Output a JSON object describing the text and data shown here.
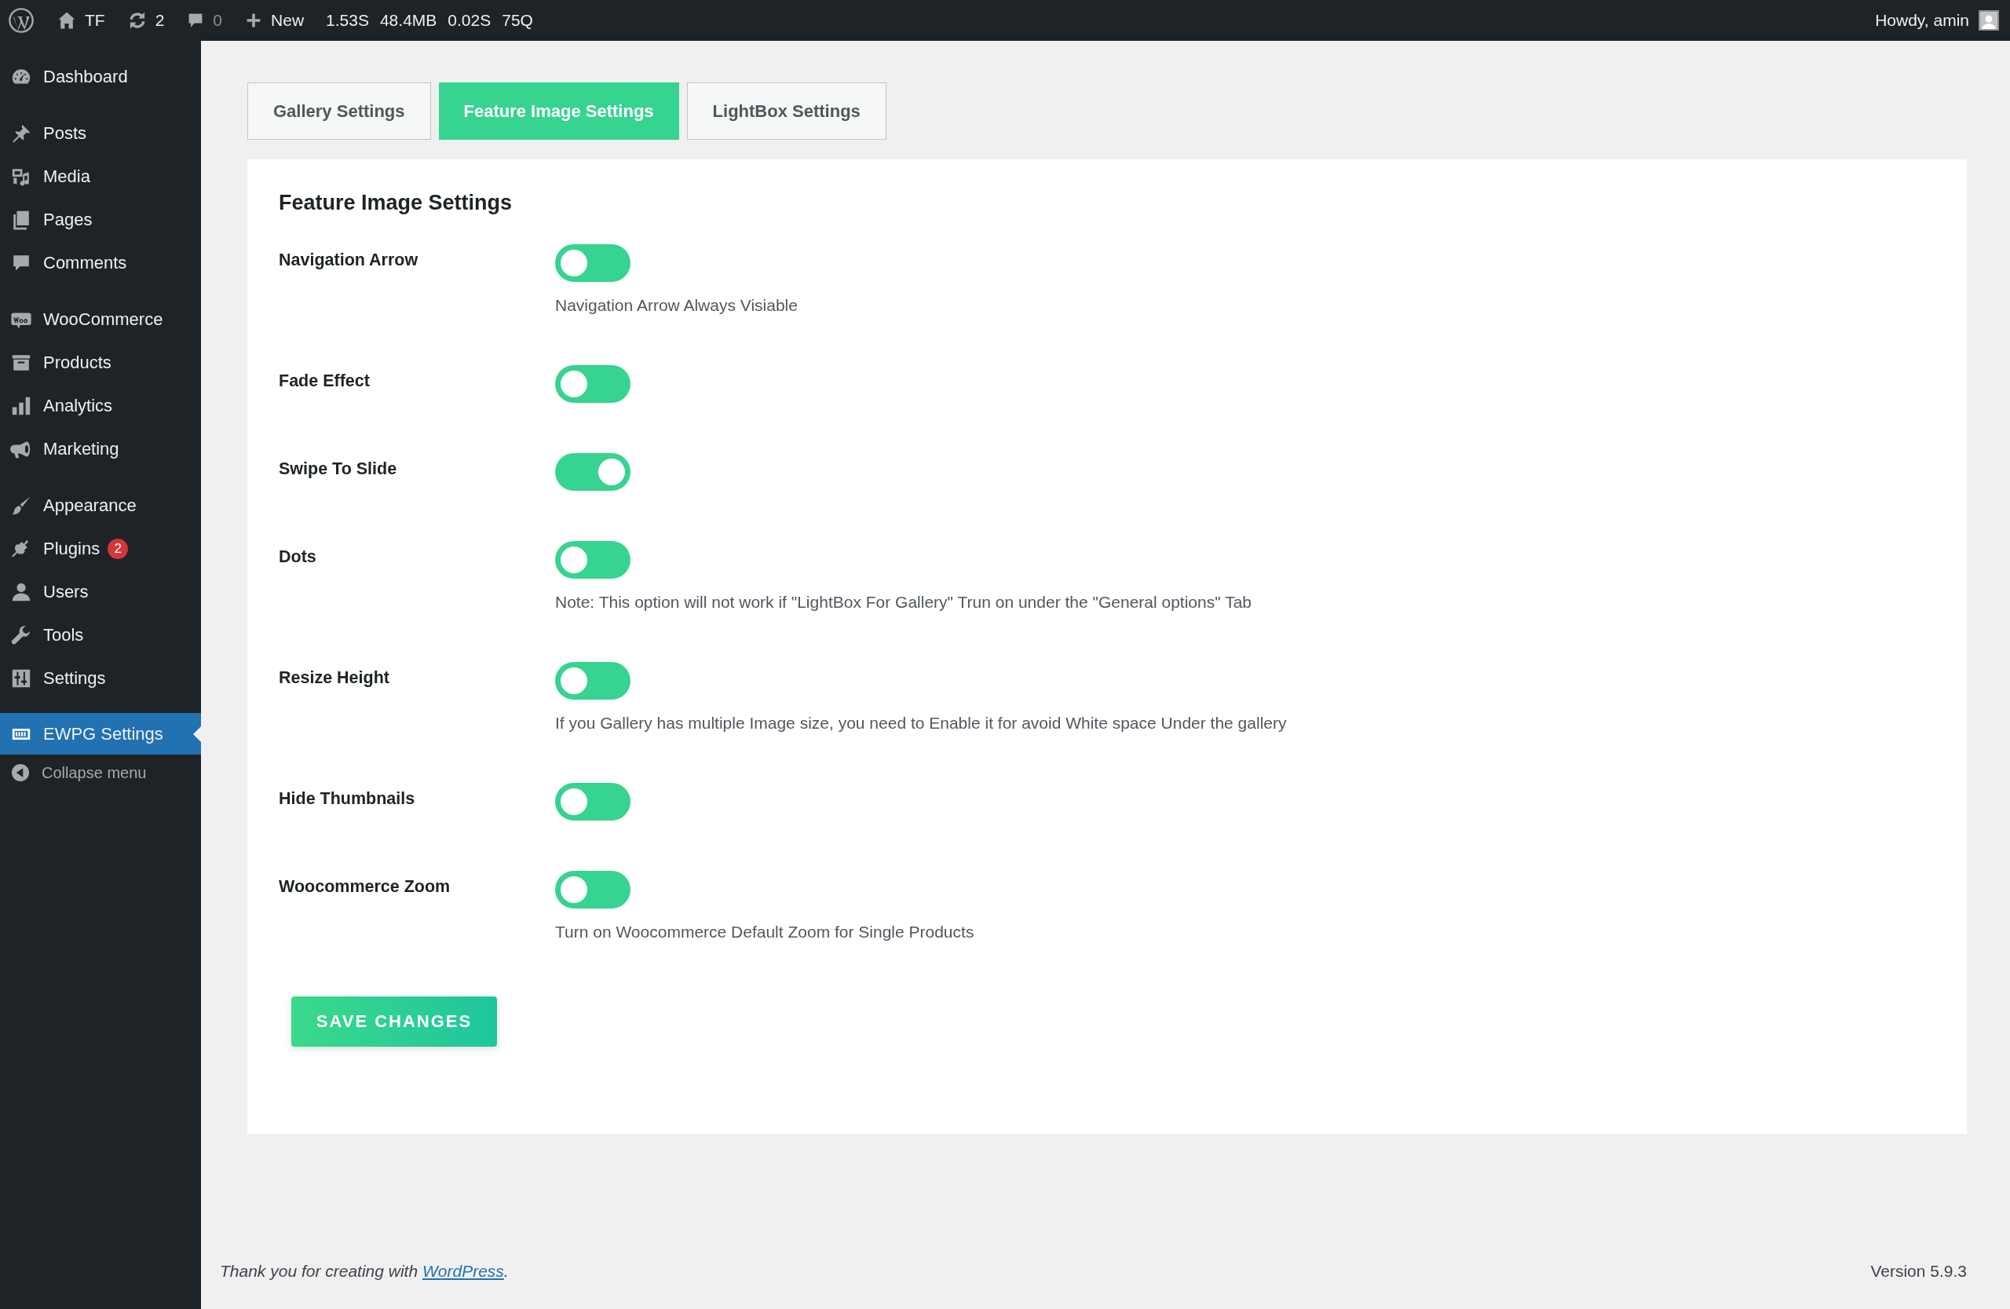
{
  "admin_bar": {
    "site": "TF",
    "updates": "2",
    "comments": "0",
    "new": "New",
    "stats": [
      "1.53S",
      "48.4MB",
      "0.02S",
      "75Q"
    ],
    "greeting": "Howdy, amin"
  },
  "sidebar": {
    "groups": [
      [
        {
          "label": "Dashboard",
          "kind": "dashboard",
          "selected": false
        }
      ],
      [
        {
          "label": "Posts",
          "kind": "pin",
          "selected": false
        },
        {
          "label": "Media",
          "kind": "media",
          "selected": false
        },
        {
          "label": "Pages",
          "kind": "pages",
          "selected": false
        },
        {
          "label": "Comments",
          "kind": "comment",
          "selected": false
        }
      ],
      [
        {
          "label": "WooCommerce",
          "kind": "woo",
          "selected": false
        },
        {
          "label": "Products",
          "kind": "archive",
          "selected": false
        },
        {
          "label": "Analytics",
          "kind": "chart",
          "selected": false
        },
        {
          "label": "Marketing",
          "kind": "megaphone",
          "selected": false
        }
      ],
      [
        {
          "label": "Appearance",
          "kind": "brush",
          "selected": false
        },
        {
          "label": "Plugins",
          "kind": "plug",
          "selected": false,
          "badge": "2"
        },
        {
          "label": "Users",
          "kind": "user",
          "selected": false
        },
        {
          "label": "Tools",
          "kind": "wrench",
          "selected": false
        },
        {
          "label": "Settings",
          "kind": "sliders",
          "selected": false
        }
      ],
      [
        {
          "label": "EWPG Settings",
          "kind": "ewpg",
          "selected": true
        }
      ]
    ],
    "collapse": "Collapse menu"
  },
  "tabs": [
    {
      "label": "Gallery Settings",
      "selected": false
    },
    {
      "label": "Feature Image Settings",
      "selected": true
    },
    {
      "label": "LightBox Settings",
      "selected": false
    }
  ],
  "panel": {
    "title": "Feature Image Settings",
    "settings": [
      {
        "label": "Navigation Arrow",
        "on": false,
        "description": "Navigation Arrow Always Visiable"
      },
      {
        "label": "Fade Effect",
        "on": false
      },
      {
        "label": "Swipe To Slide",
        "on": true
      },
      {
        "label": "Dots",
        "on": false,
        "description": "Note: This option will not work if \"LightBox For Gallery\" Trun on under the \"General options\" Tab"
      },
      {
        "label": "Resize Height",
        "on": false,
        "description": "If you Gallery has multiple Image size, you need to Enable it for avoid White space Under the gallery"
      },
      {
        "label": "Hide Thumbnails",
        "on": false
      },
      {
        "label": "Woocommerce Zoom",
        "on": false,
        "description": "Turn on Woocommerce Default Zoom for Single Products"
      }
    ],
    "save_button": "SAVE CHANGES"
  },
  "footer": {
    "thanks": "Thank you for creating with ",
    "link": "WordPress",
    "after": ".",
    "version": "Version 5.9.3"
  }
}
